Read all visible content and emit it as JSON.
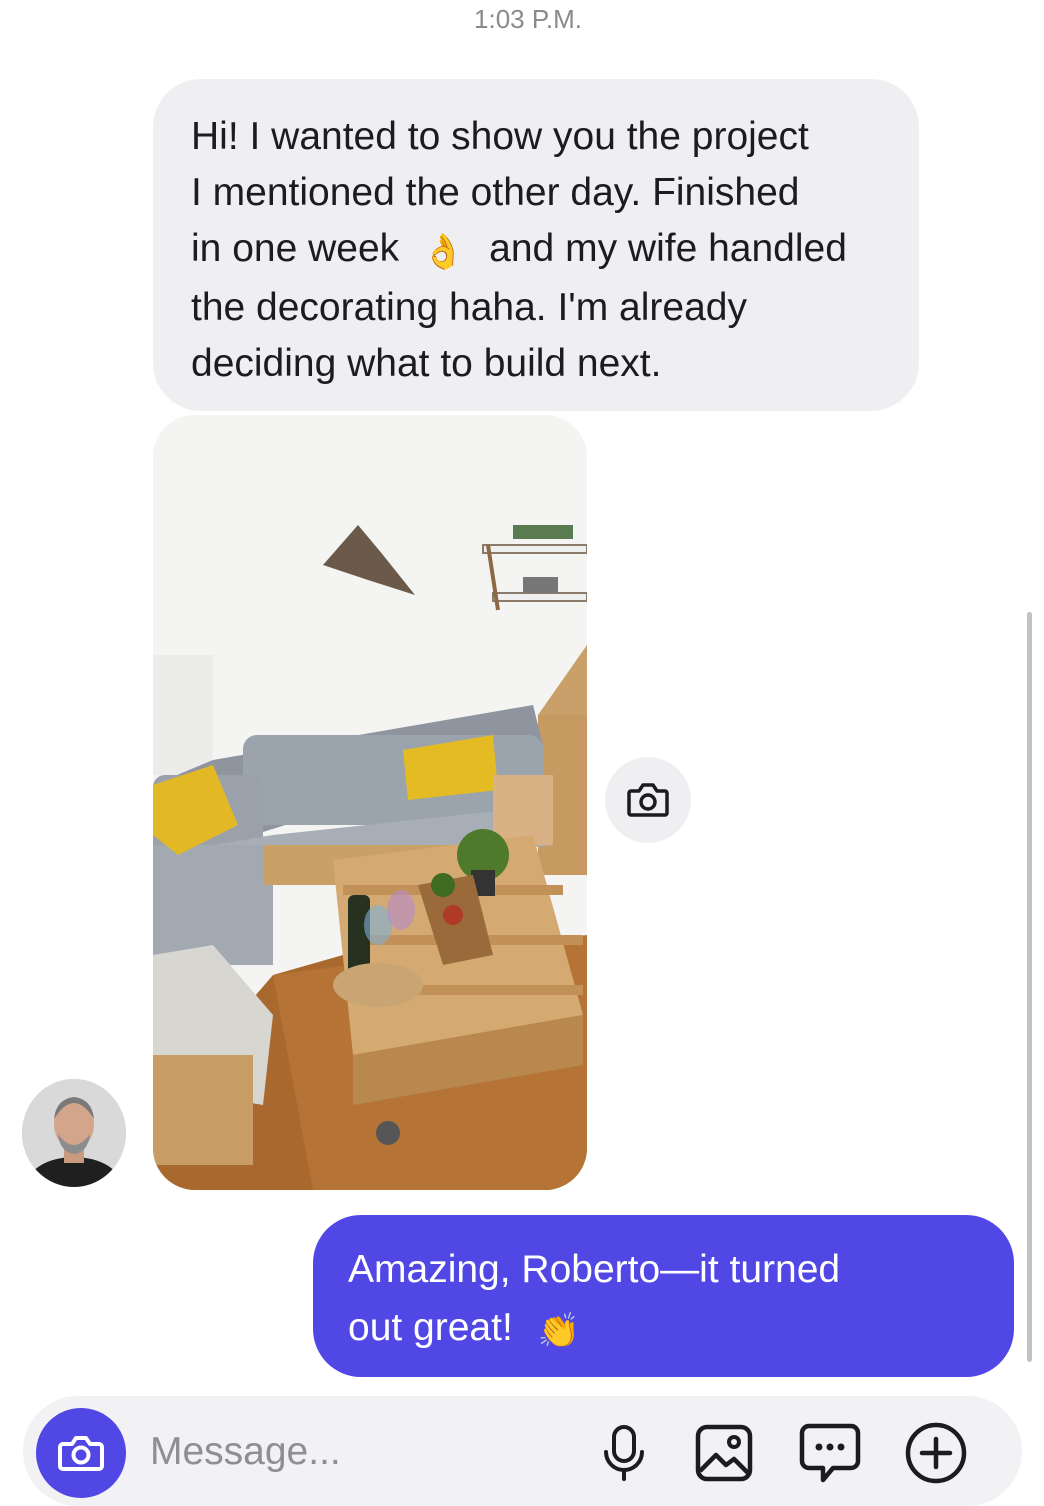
{
  "thread": {
    "timestamp": "1:03 P.M.",
    "incoming": {
      "sender": "Roberto",
      "lines": [
        "Hi! I wanted to show you the project",
        "I mentioned the other day. Finished",
        "in one week",
        "and my wife handled",
        "the decorating haha. I'm already",
        "deciding what to build next."
      ],
      "emoji": "👌",
      "photo_label": "pallet-furniture-living-room-photo"
    },
    "outgoing": {
      "lines": [
        "Amazing, Roberto—it turned",
        "out great!"
      ],
      "emoji": "👏"
    }
  },
  "composer": {
    "placeholder": "Message...",
    "value": "",
    "icons": [
      "camera-icon",
      "microphone-icon",
      "image-icon",
      "sticker-icon",
      "plus-icon"
    ]
  },
  "colors": {
    "accent": "#5147e5",
    "incoming_bubble": "#efeff2",
    "text": "#1c1c1e",
    "muted": "#8e8e93"
  }
}
